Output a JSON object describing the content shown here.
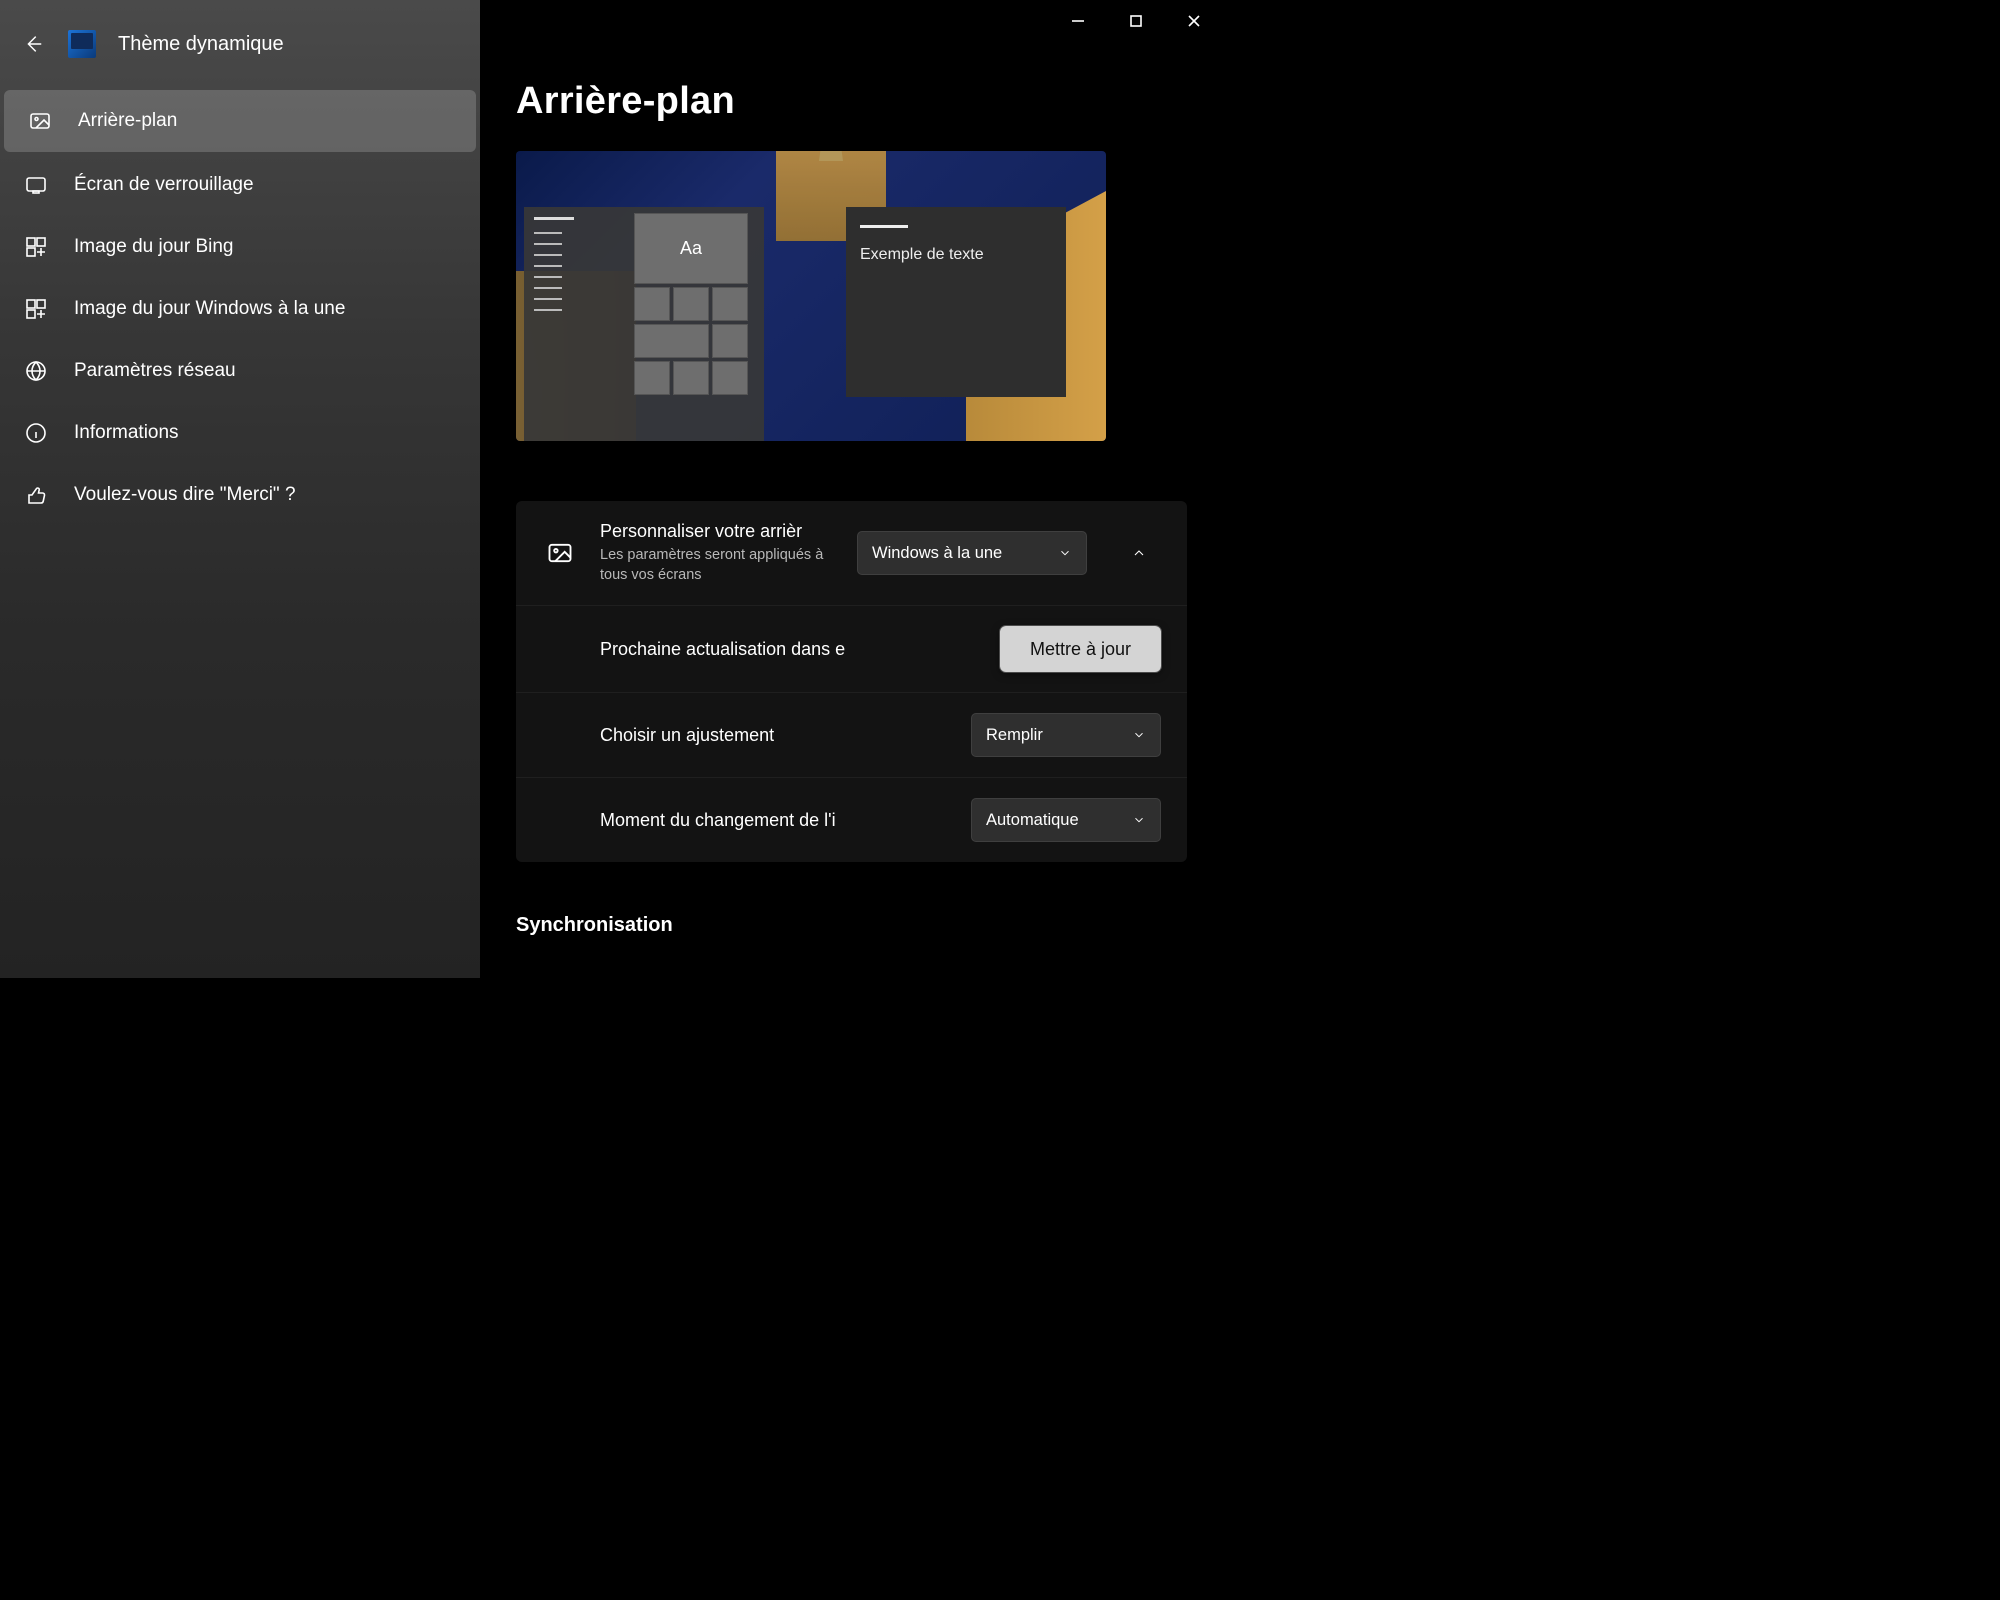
{
  "header": {
    "app_title": "Thème dynamique"
  },
  "sidebar": {
    "items": [
      {
        "label": "Arrière-plan",
        "icon": "image-icon",
        "active": true
      },
      {
        "label": "Écran de verrouillage",
        "icon": "lockscreen-icon",
        "active": false
      },
      {
        "label": "Image du jour Bing",
        "icon": "tiles-icon",
        "active": false
      },
      {
        "label": "Image du jour Windows à la une",
        "icon": "tiles-icon",
        "active": false
      },
      {
        "label": "Paramètres réseau",
        "icon": "globe-icon",
        "active": false
      },
      {
        "label": "Informations",
        "icon": "info-icon",
        "active": false
      },
      {
        "label": "Voulez-vous dire \"Merci\" ?",
        "icon": "thumbs-up-icon",
        "active": false
      }
    ]
  },
  "main": {
    "page_title": "Arrière-plan",
    "preview": {
      "aa_label": "Aa",
      "sample_text": "Exemple de texte"
    },
    "settings": {
      "personalize": {
        "title": "Personnaliser votre arrièr",
        "subtitle": "Les paramètres seront appliqués à tous vos écrans",
        "dropdown_value": "Windows à la une"
      },
      "next_refresh": {
        "title": "Prochaine actualisation dans e",
        "button": "Mettre à jour"
      },
      "fit": {
        "title": "Choisir un ajustement",
        "dropdown_value": "Remplir"
      },
      "change_moment": {
        "title": "Moment du changement de l'i",
        "dropdown_value": "Automatique"
      }
    },
    "sync_heading": "Synchronisation"
  }
}
